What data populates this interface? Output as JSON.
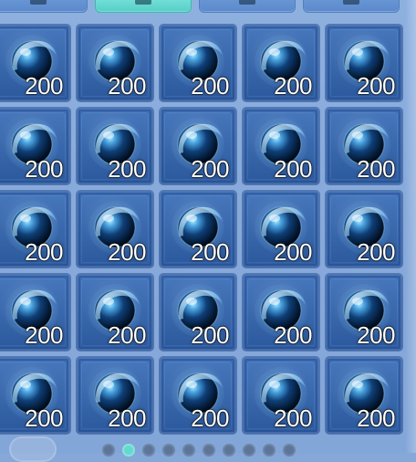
{
  "tabs": [
    {
      "label": "",
      "active": false
    },
    {
      "label": "",
      "active": true
    },
    {
      "label": "",
      "active": false
    },
    {
      "label": "",
      "active": false
    }
  ],
  "inventory": {
    "items": [
      {
        "name": "blue-orb-icon",
        "quantity": "200"
      },
      {
        "name": "blue-orb-icon",
        "quantity": "200"
      },
      {
        "name": "blue-orb-icon",
        "quantity": "200"
      },
      {
        "name": "blue-orb-icon",
        "quantity": "200"
      },
      {
        "name": "blue-orb-icon",
        "quantity": "200"
      },
      {
        "name": "blue-orb-icon",
        "quantity": "200"
      },
      {
        "name": "blue-orb-icon",
        "quantity": "200"
      },
      {
        "name": "blue-orb-icon",
        "quantity": "200"
      },
      {
        "name": "blue-orb-icon",
        "quantity": "200"
      },
      {
        "name": "blue-orb-icon",
        "quantity": "200"
      },
      {
        "name": "blue-orb-icon",
        "quantity": "200"
      },
      {
        "name": "blue-orb-icon",
        "quantity": "200"
      },
      {
        "name": "blue-orb-icon",
        "quantity": "200"
      },
      {
        "name": "blue-orb-icon",
        "quantity": "200"
      },
      {
        "name": "blue-orb-icon",
        "quantity": "200"
      },
      {
        "name": "blue-orb-icon",
        "quantity": "200"
      },
      {
        "name": "blue-orb-icon",
        "quantity": "200"
      },
      {
        "name": "blue-orb-icon",
        "quantity": "200"
      },
      {
        "name": "blue-orb-icon",
        "quantity": "200"
      },
      {
        "name": "blue-orb-icon",
        "quantity": "200"
      },
      {
        "name": "blue-orb-icon",
        "quantity": "200"
      },
      {
        "name": "blue-orb-icon",
        "quantity": "200"
      },
      {
        "name": "blue-orb-icon",
        "quantity": "200"
      },
      {
        "name": "blue-orb-icon",
        "quantity": "200"
      },
      {
        "name": "blue-orb-icon",
        "quantity": "200"
      }
    ]
  },
  "pager": {
    "dots": [
      {
        "active": false
      },
      {
        "active": true
      },
      {
        "active": false
      },
      {
        "active": false
      },
      {
        "active": false
      },
      {
        "active": false
      },
      {
        "active": false
      },
      {
        "active": false
      },
      {
        "active": false
      },
      {
        "active": false
      }
    ]
  }
}
